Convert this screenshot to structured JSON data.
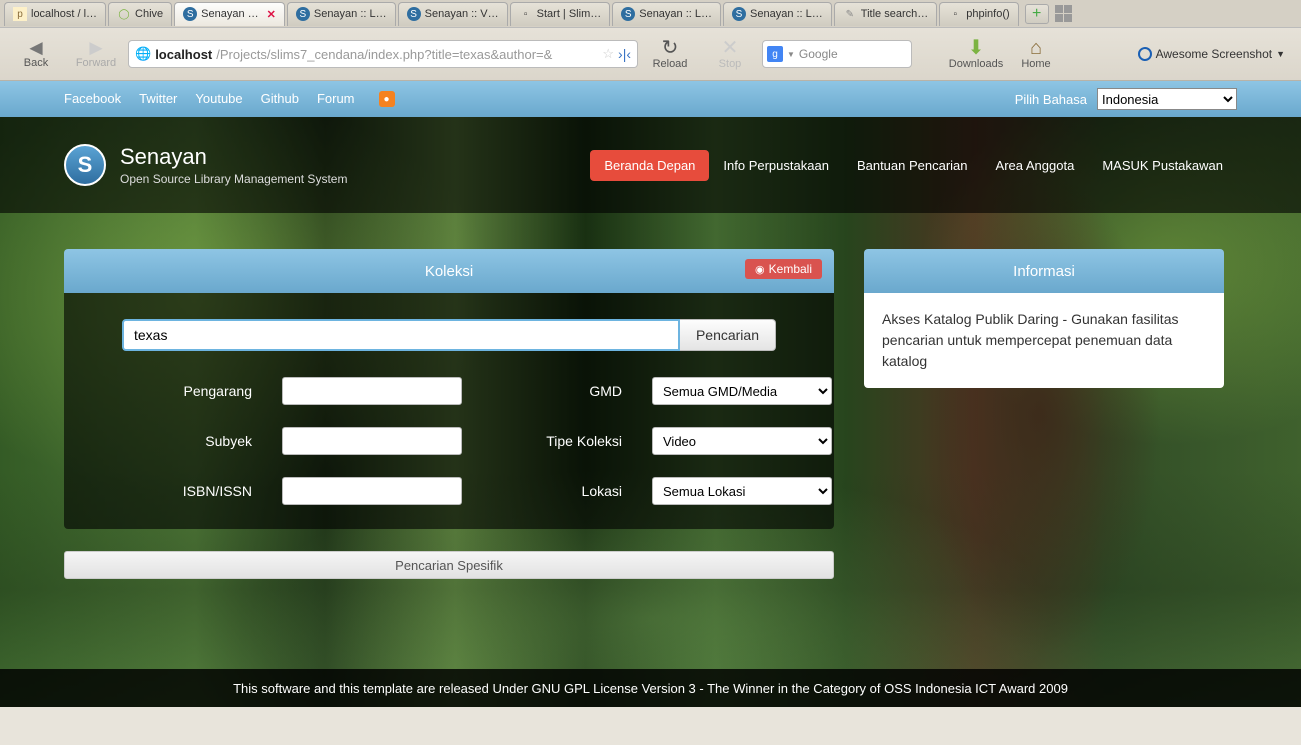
{
  "browser": {
    "tabs": [
      {
        "label": "localhost / l…",
        "active": false
      },
      {
        "label": "Chive",
        "active": false
      },
      {
        "label": "Senayan …",
        "active": true
      },
      {
        "label": "Senayan :: L…",
        "active": false
      },
      {
        "label": "Senayan :: V…",
        "active": false
      },
      {
        "label": "Start | Slim…",
        "active": false
      },
      {
        "label": "Senayan :: L…",
        "active": false
      },
      {
        "label": "Senayan :: L…",
        "active": false
      },
      {
        "label": "Title search…",
        "active": false
      },
      {
        "label": "phpinfo()",
        "active": false
      }
    ],
    "nav": {
      "back": "Back",
      "forward": "Forward",
      "reload": "Reload",
      "stop": "Stop",
      "downloads": "Downloads",
      "home": "Home"
    },
    "url_host": "localhost",
    "url_path": "/Projects/slims7_cendana/index.php?title=texas&author=&",
    "search_placeholder": "Google",
    "screenshot": "Awesome Screenshot"
  },
  "topbar": {
    "links": [
      "Facebook",
      "Twitter",
      "Youtube",
      "Github",
      "Forum"
    ],
    "lang_label": "Pilih Bahasa",
    "lang_value": "Indonesia"
  },
  "brand": {
    "title": "Senayan",
    "subtitle": "Open Source Library Management System"
  },
  "nav": {
    "items": [
      "Beranda Depan",
      "Info Perpustakaan",
      "Bantuan Pencarian",
      "Area Anggota",
      "MASUK Pustakawan"
    ],
    "active_index": 0
  },
  "koleksi": {
    "title": "Koleksi",
    "back": "Kembali",
    "search_value": "texas",
    "search_button": "Pencarian",
    "fields": {
      "pengarang": "Pengarang",
      "gmd": "GMD",
      "gmd_value": "Semua GMD/Media",
      "subyek": "Subyek",
      "tipe": "Tipe Koleksi",
      "tipe_value": "Video",
      "isbn": "ISBN/ISSN",
      "lokasi": "Lokasi",
      "lokasi_value": "Semua Lokasi"
    },
    "specific": "Pencarian Spesifik"
  },
  "info": {
    "title": "Informasi",
    "body": "Akses Katalog Publik Daring - Gunakan fasilitas pencarian untuk mempercepat penemuan data katalog"
  },
  "footer": "This software and this template are released Under GNU GPL License Version 3 - The Winner in the Category of OSS Indonesia ICT Award 2009"
}
